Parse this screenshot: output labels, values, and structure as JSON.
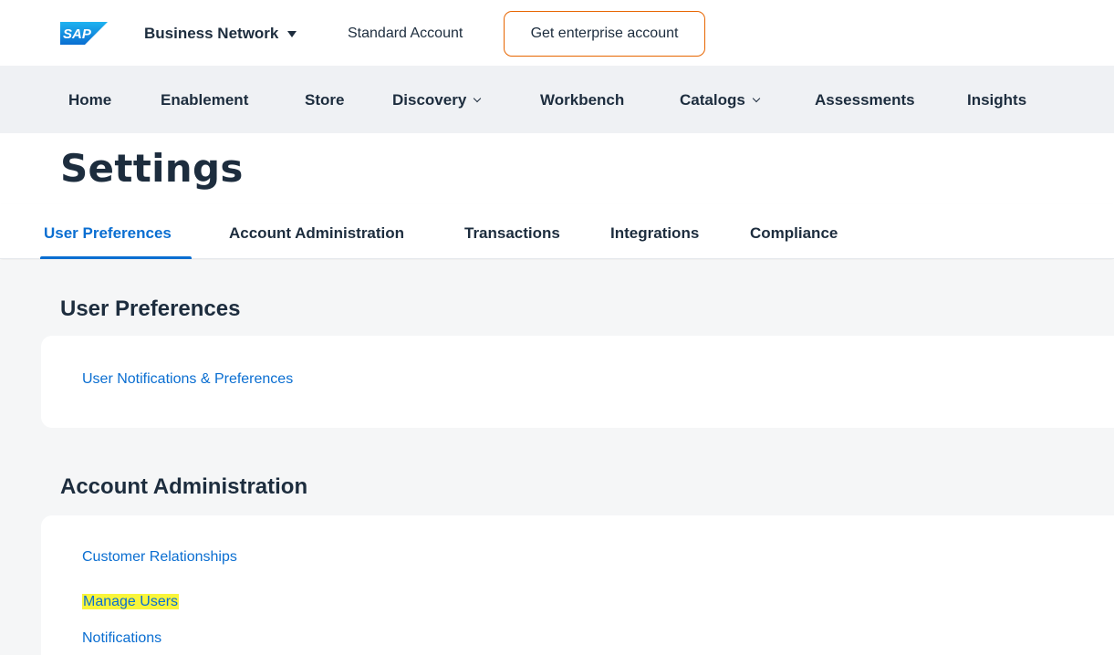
{
  "shell": {
    "logo_text": "SAP",
    "brand_label": "Business Network",
    "account_type": "Standard Account",
    "enterprise_button": "Get enterprise account",
    "accent_color": "#e76500"
  },
  "nav": {
    "items": [
      {
        "label": "Home"
      },
      {
        "label": "Enablement"
      },
      {
        "label": "Store"
      },
      {
        "label": "Discovery"
      },
      {
        "label": "Workbench"
      },
      {
        "label": "Catalogs"
      },
      {
        "label": "Assessments"
      },
      {
        "label": "Insights"
      }
    ]
  },
  "page": {
    "title": "Settings"
  },
  "tabs": {
    "items": [
      {
        "label": "User Preferences",
        "active": true
      },
      {
        "label": "Account Administration"
      },
      {
        "label": "Transactions"
      },
      {
        "label": "Integrations"
      },
      {
        "label": "Compliance"
      }
    ],
    "active_color": "#0a6ed1"
  },
  "sections": {
    "user_preferences": {
      "title": "User Preferences",
      "links": [
        "User Notifications & Preferences"
      ]
    },
    "account_administration": {
      "title": "Account Administration",
      "links": [
        "Customer Relationships",
        "Manage Users",
        "Notifications"
      ]
    }
  },
  "highlight_color": "#f9f53a"
}
